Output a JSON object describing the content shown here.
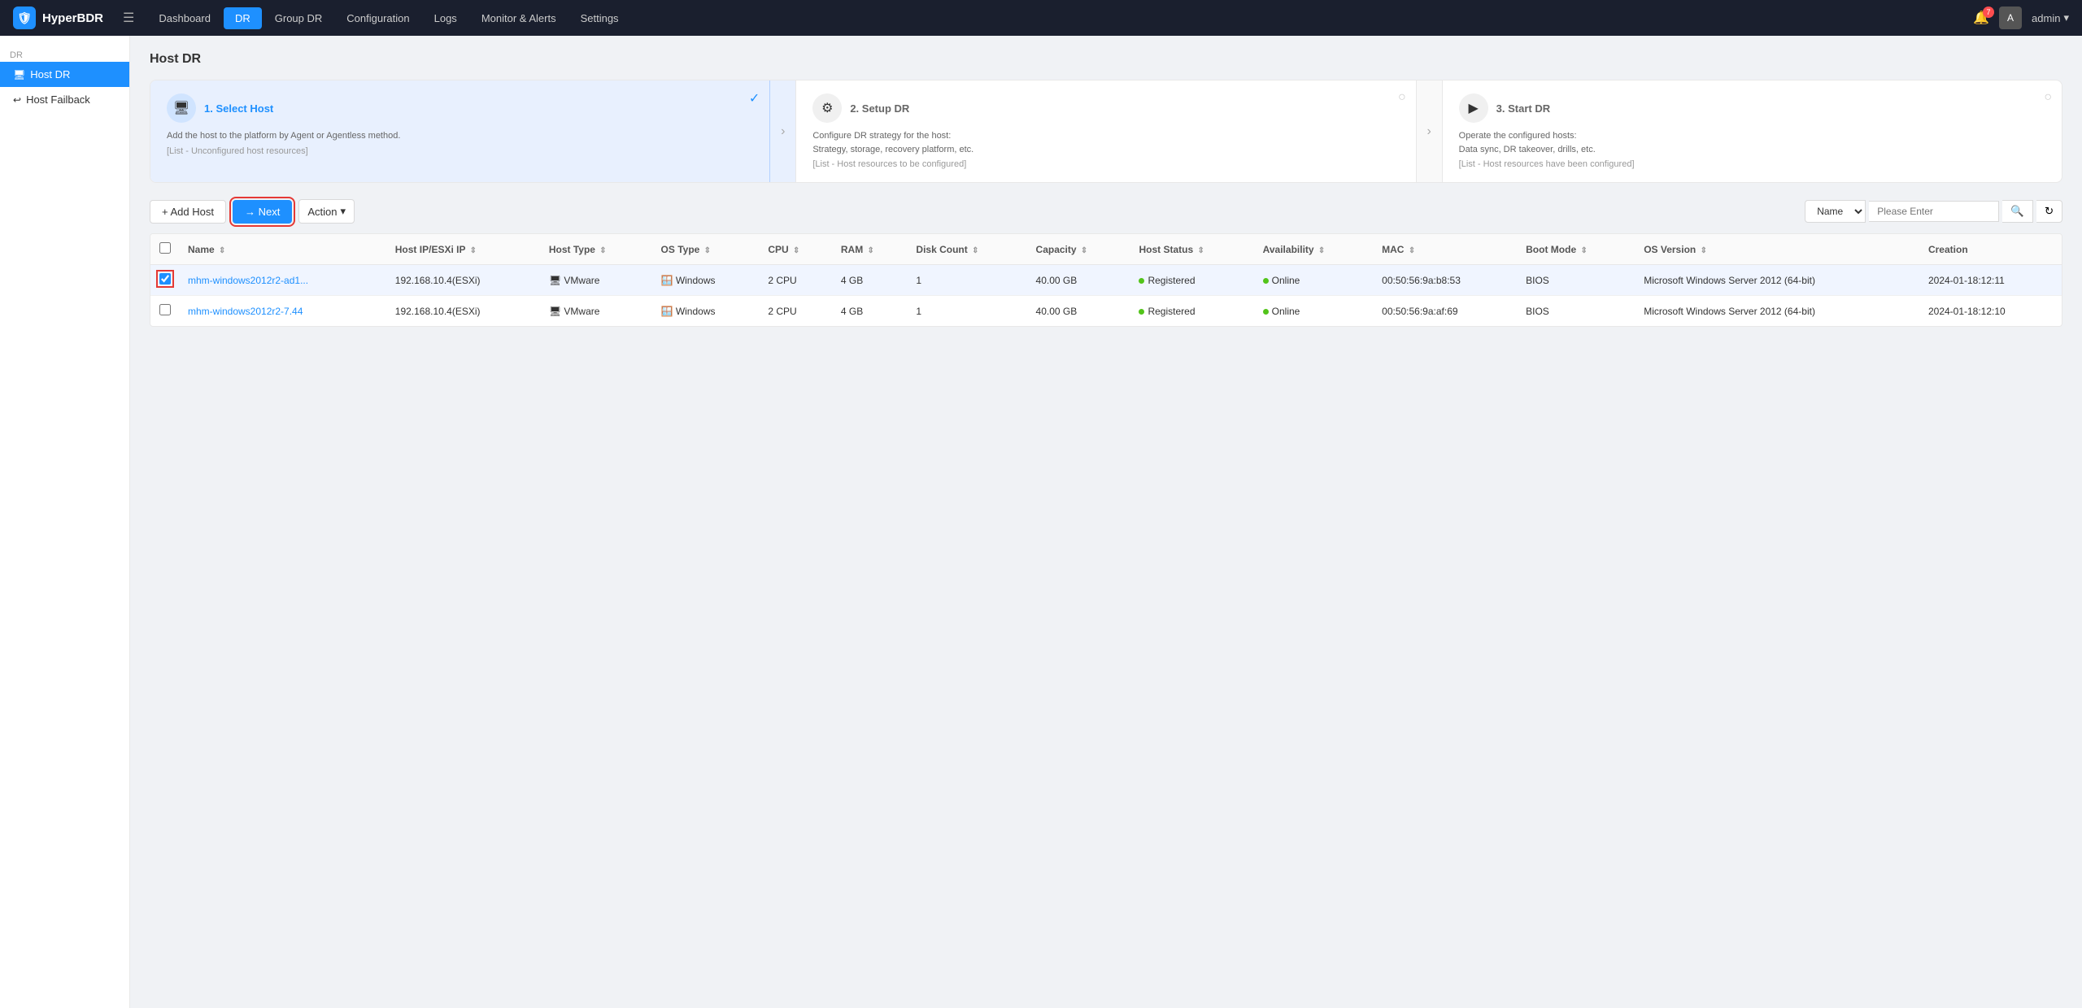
{
  "app": {
    "name": "HyperBDR",
    "logo_icon": "🛡"
  },
  "topnav": {
    "hamburger": "☰",
    "items": [
      {
        "label": "Dashboard",
        "active": false
      },
      {
        "label": "DR",
        "active": true
      },
      {
        "label": "Group DR",
        "active": false
      },
      {
        "label": "Configuration",
        "active": false
      },
      {
        "label": "Logs",
        "active": false
      },
      {
        "label": "Monitor & Alerts",
        "active": false
      },
      {
        "label": "Settings",
        "active": false
      }
    ],
    "bell_count": "7",
    "avatar_label": "A",
    "user_label": "admin",
    "user_arrow": "▾"
  },
  "sidebar": {
    "section": "DR",
    "items": [
      {
        "label": "Host DR",
        "active": true
      },
      {
        "label": "Host Failback",
        "active": false
      }
    ]
  },
  "page_title": "Host DR",
  "steps": [
    {
      "number": "1",
      "title": "1. Select Host",
      "desc1": "Add the host to the platform by Agent or Agentless method.",
      "desc2": "[List - Unconfigured host resources]",
      "active": true,
      "check": "✓"
    },
    {
      "number": "2",
      "title": "2. Setup DR",
      "desc1": "Configure DR strategy for the host:",
      "desc2": "Strategy, storage, recovery platform, etc.",
      "desc3": "[List - Host resources to be configured]",
      "active": false,
      "check": "○"
    },
    {
      "number": "3",
      "title": "3. Start DR",
      "desc1": "Operate the configured hosts:",
      "desc2": "Data sync, DR takeover, drills, etc.",
      "desc3": "[List - Host resources have been configured]",
      "active": false,
      "check": "○"
    }
  ],
  "toolbar": {
    "add_host_label": "+ Add Host",
    "next_label": "→ Next",
    "action_label": "Action",
    "action_arrow": "▾",
    "search_select_label": "Name",
    "search_placeholder": "Please Enter",
    "search_icon": "🔍",
    "refresh_icon": "↻"
  },
  "table": {
    "columns": [
      "Name",
      "Host IP/ESXi IP",
      "Host Type",
      "OS Type",
      "CPU",
      "RAM",
      "Disk Count",
      "Capacity",
      "Host Status",
      "Availability",
      "MAC",
      "Boot Mode",
      "OS Version",
      "Creation"
    ],
    "rows": [
      {
        "checked": true,
        "name": "mhm-windows2012r2-ad1...",
        "host_ip": "192.168.10.4(ESXi)",
        "host_type_icon": "VMware",
        "host_type": "VMware",
        "os_type_icon": "Windows",
        "os_type": "Windows",
        "cpu": "2 CPU",
        "ram": "4 GB",
        "disk_count": "1",
        "capacity": "40.00 GB",
        "host_status_dot": "green",
        "host_status": "Registered",
        "availability_dot": "green",
        "availability": "Online",
        "mac": "00:50:56:9a:b8:53",
        "boot_mode": "BIOS",
        "os_version": "Microsoft Windows Server 2012 (64-bit)",
        "creation": "2024-01-18:12:11"
      },
      {
        "checked": false,
        "name": "mhm-windows2012r2-7.44",
        "host_ip": "192.168.10.4(ESXi)",
        "host_type_icon": "VMware",
        "host_type": "VMware",
        "os_type_icon": "Windows",
        "os_type": "Windows",
        "cpu": "2 CPU",
        "ram": "4 GB",
        "disk_count": "1",
        "capacity": "40.00 GB",
        "host_status_dot": "green",
        "host_status": "Registered",
        "availability_dot": "green",
        "availability": "Online",
        "mac": "00:50:56:9a:af:69",
        "boot_mode": "BIOS",
        "os_version": "Microsoft Windows Server 2012 (64-bit)",
        "creation": "2024-01-18:12:10"
      }
    ]
  }
}
